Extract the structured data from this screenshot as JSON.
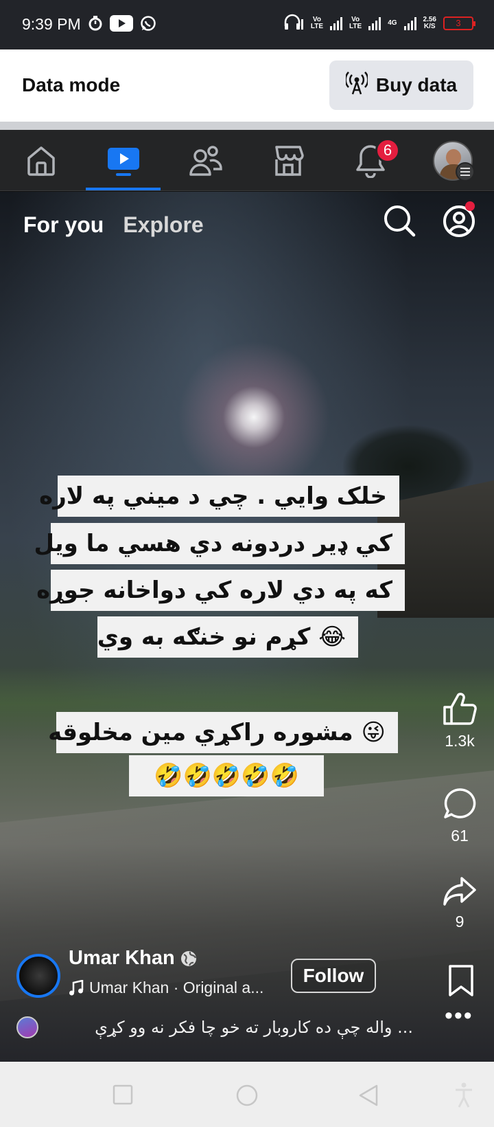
{
  "status_bar": {
    "time": "9:39 PM",
    "network_1": "Vo\nLTE",
    "network_2": "Vo\nLTE",
    "network_type": "4G",
    "speed_value": "2.56",
    "speed_unit": "K/S",
    "battery": "3",
    "battery_color": "#dd2222"
  },
  "data_bar": {
    "label": "Data mode",
    "button_label": "Buy data"
  },
  "nav": {
    "notifications_badge": "6",
    "accent_color": "#1877f2",
    "items": [
      "home-icon",
      "video-icon",
      "friends-icon",
      "marketplace-icon",
      "bell-icon",
      "profile-avatar"
    ]
  },
  "video": {
    "tabs": [
      "For you",
      "Explore"
    ],
    "caption_lines": [
      "خلک وايي . چي د ميني په لاره",
      "کي ډير دردونه دي هسي ما ويل",
      "که په دي لاره کي دواخانه جوړه",
      "😂 کړم نو خنګه به وي",
      "😜 مشوره راکړي مين مخلوقه",
      "🤣🤣🤣🤣🤣"
    ],
    "likes": "1.3k",
    "comments": "61",
    "shares": "9",
    "author_name": "Umar Khan",
    "music": "Umar Khan · Original a...",
    "follow_label": "Follow",
    "more_label": "•••",
    "comment_text": "واله چې ده کاروبار ته خو چا فکر نه وو کړې   ..."
  }
}
